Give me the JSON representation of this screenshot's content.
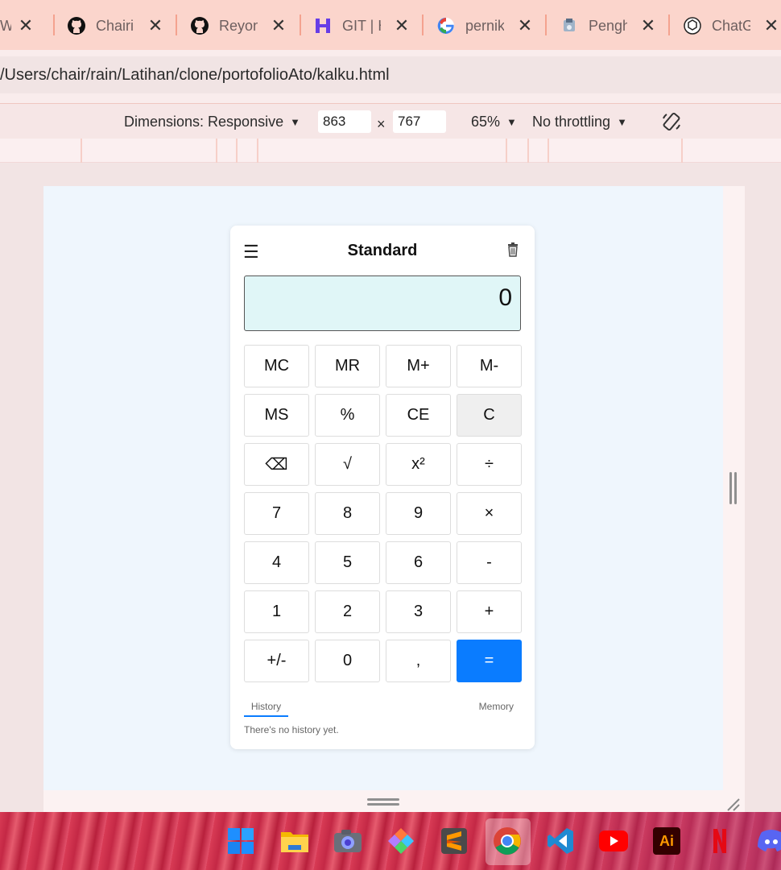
{
  "browser": {
    "tabs": [
      {
        "title": "W",
        "icon": "web-icon"
      },
      {
        "title": "Chairi",
        "icon": "github-icon"
      },
      {
        "title": "Reyon",
        "icon": "github-icon"
      },
      {
        "title": "GIT | H",
        "icon": "hostinger-icon"
      },
      {
        "title": "pernik",
        "icon": "google-icon"
      },
      {
        "title": "Pengh",
        "icon": "govt-site-icon"
      },
      {
        "title": "ChatG",
        "icon": "chatgpt-icon"
      }
    ],
    "address": "/Users/chair/rain/Latihan/clone/portofolioAto/kalku.html"
  },
  "devtools": {
    "dimensions_label": "Dimensions: Responsive",
    "width": "863",
    "times": "×",
    "height": "767",
    "zoom": "65%",
    "throttling": "No throttling",
    "rotate_icon": "rotate-icon"
  },
  "calculator": {
    "title": "Standard",
    "menu_icon": "☰",
    "display": "0",
    "keys": [
      {
        "label": "MC"
      },
      {
        "label": "MR"
      },
      {
        "label": "M+"
      },
      {
        "label": "M-"
      },
      {
        "label": "MS"
      },
      {
        "label": "%"
      },
      {
        "label": "CE"
      },
      {
        "label": "C"
      },
      {
        "label": "⌫"
      },
      {
        "label": "√"
      },
      {
        "label": "x²"
      },
      {
        "label": "÷"
      },
      {
        "label": "7"
      },
      {
        "label": "8"
      },
      {
        "label": "9"
      },
      {
        "label": "×"
      },
      {
        "label": "4"
      },
      {
        "label": "5"
      },
      {
        "label": "6"
      },
      {
        "label": "-"
      },
      {
        "label": "1"
      },
      {
        "label": "2"
      },
      {
        "label": "3"
      },
      {
        "label": "+"
      },
      {
        "label": "+/-"
      },
      {
        "label": "0"
      },
      {
        "label": ","
      },
      {
        "label": "="
      }
    ],
    "tab_history": "History",
    "tab_memory": "Memory",
    "history_empty": "There's no history yet.",
    "accent_color": "#0a7cff",
    "display_color": "#e0f6f7"
  },
  "taskbar": {
    "apps": [
      "windows-start-icon",
      "file-explorer-icon",
      "camera-icon",
      "app-icon",
      "sublime-text-icon",
      "chrome-icon",
      "vscode-icon",
      "youtube-icon",
      "illustrator-icon",
      "netflix-icon",
      "discord-icon"
    ],
    "illustrator_label": "Ai"
  }
}
